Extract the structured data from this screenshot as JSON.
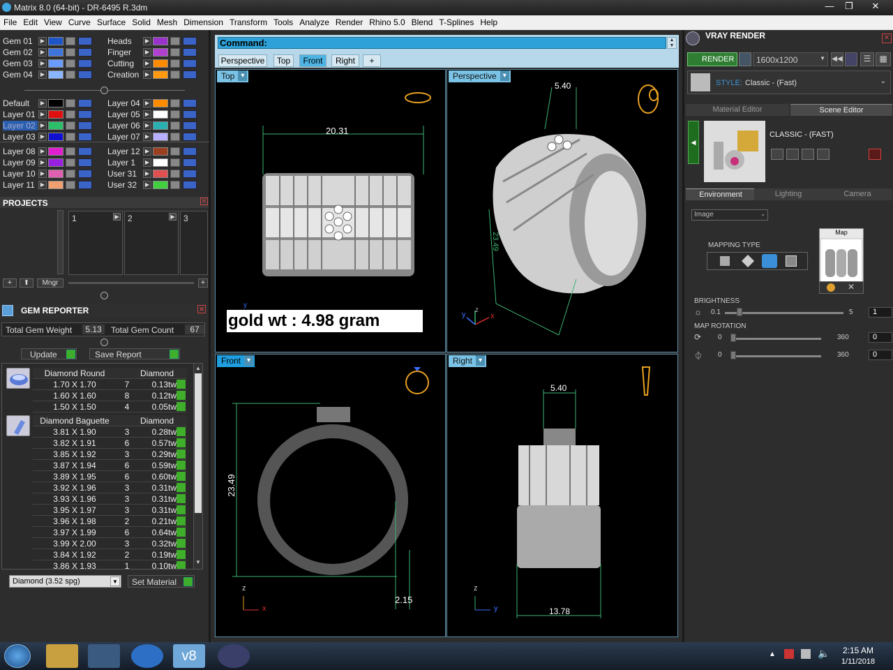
{
  "window": {
    "title": "Matrix 8.0 (64-bit) - DR-6495 R.3dm",
    "min": "—",
    "max": "❐",
    "close": "✕"
  },
  "menu": [
    "File",
    "Edit",
    "View",
    "Curve",
    "Surface",
    "Solid",
    "Mesh",
    "Dimension",
    "Transform",
    "Tools",
    "Analyze",
    "Render",
    "Rhino 5.0",
    "Blend",
    "T-Splines",
    "Help"
  ],
  "layers_top": [
    {
      "name": "Gem 01",
      "color": "#1e56c8"
    },
    {
      "name": "Gem 02",
      "color": "#3f74dc"
    },
    {
      "name": "Gem 03",
      "color": "#6a9bff"
    },
    {
      "name": "Gem 04",
      "color": "#8ab6ff"
    }
  ],
  "layers_top_right": [
    {
      "name": "Heads",
      "color": "#9933cc"
    },
    {
      "name": "Finger",
      "color": "#b040d0"
    },
    {
      "name": "Cutting",
      "color": "#ff8c00"
    },
    {
      "name": "Creation",
      "color": "#ff9a10"
    }
  ],
  "layers_mid": [
    {
      "name": "Default",
      "color": "#000000"
    },
    {
      "name": "Layer 01",
      "color": "#e01010"
    },
    {
      "name": "Layer 02",
      "color": "#2bbf6a"
    },
    {
      "name": "Layer 03",
      "color": "#1010d0"
    }
  ],
  "layers_mid_right": [
    {
      "name": "Layer 04",
      "color": "#ff8c00"
    },
    {
      "name": "Layer 05",
      "color": "#ffffff"
    },
    {
      "name": "Layer 06",
      "color": "#2ab0b0"
    },
    {
      "name": "Layer 07",
      "color": "#b8b0ff"
    }
  ],
  "layers_bot": [
    {
      "name": "Layer 08",
      "color": "#e020d0"
    },
    {
      "name": "Layer 09",
      "color": "#9a20e0"
    },
    {
      "name": "Layer 10",
      "color": "#e060b0"
    },
    {
      "name": "Layer 11",
      "color": "#f0a070"
    }
  ],
  "layers_bot_right": [
    {
      "name": "Layer 12",
      "color": "#9a4020"
    },
    {
      "name": "Layer 1",
      "color": "#ffffff"
    },
    {
      "name": "User 31",
      "color": "#e05050"
    },
    {
      "name": "User 32",
      "color": "#40d040"
    }
  ],
  "projects": {
    "title": "PROJECTS",
    "slots": [
      "1",
      "2",
      "3"
    ],
    "mngr": "Mngr"
  },
  "gem_reporter": {
    "title": "GEM REPORTER",
    "total_weight_label": "Total Gem Weight",
    "total_weight": "5.13",
    "total_count_label": "Total Gem Count",
    "total_count": "67",
    "update": "Update",
    "save_report": "Save Report",
    "group1": {
      "shape": "Diamond Round",
      "material": "Diamond",
      "rows": [
        [
          "1.70 X 1.70",
          "7",
          "0.13tw"
        ],
        [
          "1.60 X 1.60",
          "8",
          "0.12tw"
        ],
        [
          "1.50 X 1.50",
          "4",
          "0.05tw"
        ]
      ]
    },
    "group2": {
      "shape": "Diamond Baguette",
      "material": "Diamond",
      "rows": [
        [
          "3.81 X 1.90",
          "3",
          "0.28tw"
        ],
        [
          "3.82 X 1.91",
          "6",
          "0.57tw"
        ],
        [
          "3.85 X 1.92",
          "3",
          "0.29tw"
        ],
        [
          "3.87 X 1.94",
          "6",
          "0.59tw"
        ],
        [
          "3.89 X 1.95",
          "6",
          "0.60tw"
        ],
        [
          "3.92 X 1.96",
          "3",
          "0.31tw"
        ],
        [
          "3.93 X 1.96",
          "3",
          "0.31tw"
        ],
        [
          "3.95 X 1.97",
          "3",
          "0.31tw"
        ],
        [
          "3.96 X 1.98",
          "2",
          "0.21tw"
        ],
        [
          "3.97 X 1.99",
          "6",
          "0.64tw"
        ],
        [
          "3.99 X 2.00",
          "3",
          "0.32tw"
        ],
        [
          "3.84 X 1.92",
          "2",
          "0.19tw"
        ],
        [
          "3.86 X 1.93",
          "1",
          "0.10tw"
        ]
      ]
    },
    "material_select": "Diamond    (3.52 spg)",
    "set_material": "Set Material"
  },
  "command": {
    "label": "Command:"
  },
  "tabs": [
    "Perspective",
    "Top",
    "Front",
    "Right",
    "+"
  ],
  "viewports": {
    "top": {
      "label": "Top",
      "dim": "20.31",
      "note": "gold wt : 4.98 gram"
    },
    "perspective": {
      "label": "Perspective",
      "dim1": "5.40",
      "dim2": "23.49",
      "axis_z": "z",
      "axis_x": "x",
      "axis_y": "y"
    },
    "front": {
      "label": "Front",
      "dim1": "23.49",
      "dim2": "2.15",
      "axis_z": "z",
      "axis_x": "x"
    },
    "right": {
      "label": "Right",
      "dim1": "5.40",
      "dim2": "13.78",
      "axis_z": "z",
      "axis_y": "y"
    }
  },
  "vray": {
    "title": "VRAY RENDER",
    "render": "RENDER",
    "resolution": "1600x1200",
    "style_label": "STYLE:",
    "style_value": "Classic - (Fast)",
    "tab_material": "Material Editor",
    "tab_scene": "Scene Editor",
    "preset_name": "CLASSIC - (FAST)",
    "tabs2": [
      "Environment",
      "Lighting",
      "Camera"
    ],
    "env_select": "Image",
    "mapping_type": "MAPPING TYPE",
    "map": "Map",
    "brightness": {
      "label": "BRIGHTNESS",
      "min": "0.1",
      "max": "5",
      "value": "1",
      "level": 0.1
    },
    "map_rotation": {
      "label": "MAP ROTATION",
      "min": "0",
      "max": "360",
      "value1": "0",
      "value2": "0"
    }
  },
  "taskbar": {
    "time": "2:15 AM",
    "date": "1/11/2018",
    "v8": "v8"
  }
}
